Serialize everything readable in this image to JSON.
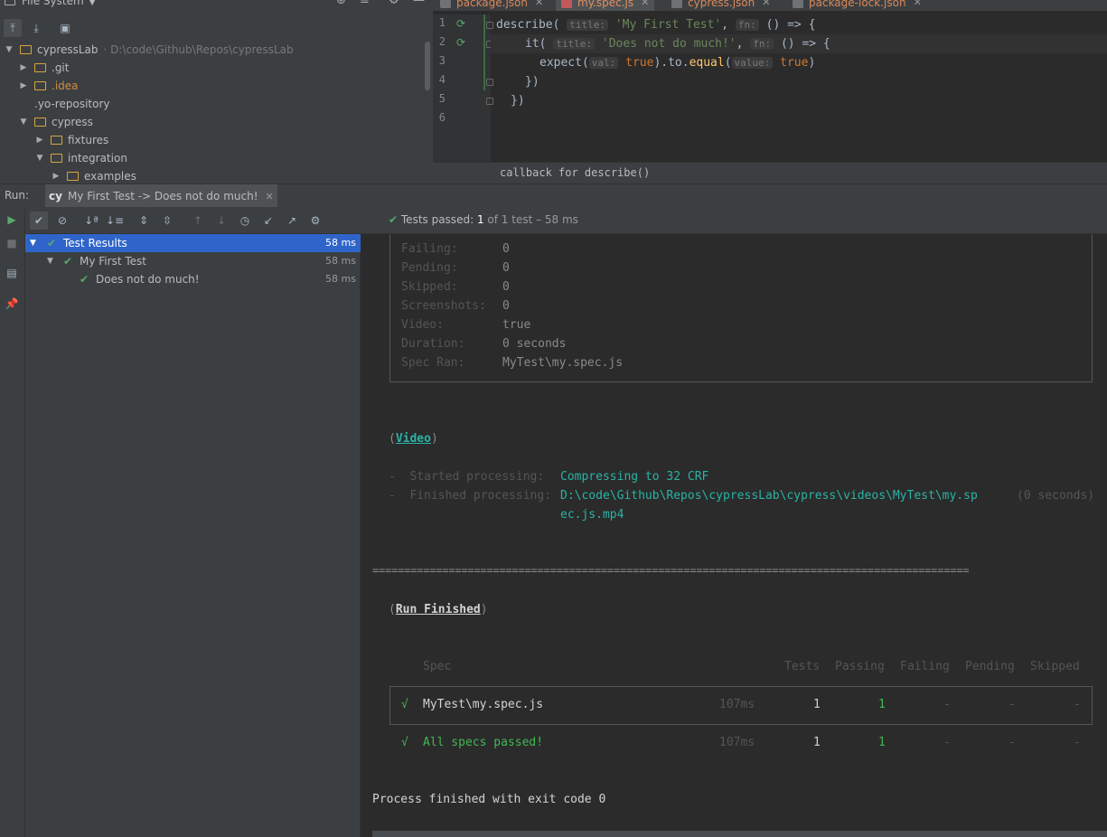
{
  "project_panel": {
    "title": "File System",
    "tree": [
      {
        "label": "cypressLab",
        "hint": "D:\\code\\Github\\Repos\\cypressLab",
        "level": 0,
        "expanded": true,
        "type": "folder-open"
      },
      {
        "label": ".git",
        "level": 1,
        "expanded": false,
        "type": "folder"
      },
      {
        "label": ".idea",
        "level": 1,
        "expanded": false,
        "type": "folder"
      },
      {
        "label": ".yo-repository",
        "level": 1,
        "type": "file"
      },
      {
        "label": "cypress",
        "level": 1,
        "expanded": true,
        "type": "folder"
      },
      {
        "label": "fixtures",
        "level": 2,
        "expanded": false,
        "type": "folder"
      },
      {
        "label": "integration",
        "level": 2,
        "expanded": true,
        "type": "folder"
      },
      {
        "label": "examples",
        "level": 3,
        "expanded": false,
        "type": "folder"
      }
    ]
  },
  "editor": {
    "tabs": [
      {
        "label": "package.json",
        "active": false
      },
      {
        "label": "my.spec.js",
        "active": true
      },
      {
        "label": "cypress.json",
        "active": false
      },
      {
        "label": "package-lock.json",
        "active": false
      }
    ],
    "line_numbers": [
      "1",
      "2",
      "3",
      "4",
      "5",
      "6"
    ],
    "code": {
      "l1": {
        "fn": "describe(",
        "hint1": "title:",
        "str": "'My First Test'",
        "comma": ", ",
        "hint2": "fn:",
        "rest": " () => {"
      },
      "l2": {
        "fn": "it(",
        "hint1": "title:",
        "str": "'Does not do much!'",
        "comma": ", ",
        "hint2": "fn:",
        "rest": " () => {"
      },
      "l3": {
        "fn": "expect(",
        "hint1": "val:",
        "v1": "true",
        "mid": ").to.",
        "m": "equal",
        "paren": "(",
        "hint2": "value:",
        "v2": "true",
        "close": ")"
      },
      "l4": "})",
      "l5": "})"
    },
    "breadcrumb": "callback for describe()"
  },
  "run_panel": {
    "label": "Run:",
    "tab_prefix": "cy",
    "tab_label": "My First Test -> Does not do much!",
    "status_prefix": "Tests passed:",
    "status_count": "1",
    "status_rest": "of 1 test – 58 ms",
    "results": [
      {
        "label": "Test Results",
        "duration": "58 ms",
        "level": 0,
        "selected": true
      },
      {
        "label": "My First Test",
        "duration": "58 ms",
        "level": 1,
        "selected": false
      },
      {
        "label": "Does not do much!",
        "duration": "58 ms",
        "level": 2,
        "selected": false
      }
    ]
  },
  "console": {
    "stats": [
      {
        "key": "Failing:",
        "value": "0"
      },
      {
        "key": "Pending:",
        "value": "0"
      },
      {
        "key": "Skipped:",
        "value": "0"
      },
      {
        "key": "Screenshots:",
        "value": "0"
      },
      {
        "key": "Video:",
        "value": "true"
      },
      {
        "key": "Duration:",
        "value": "0 seconds"
      },
      {
        "key": "Spec Ran:",
        "value": "MyTest\\my.spec.js"
      }
    ],
    "video_heading": "Video",
    "started_label": "-  Started processing:",
    "started_value": "Compressing to 32 CRF",
    "finished_label": "-  Finished processing:",
    "finished_value_1": "D:\\code\\Github\\Repos\\cypressLab\\cypress\\videos\\MyTest\\my.sp",
    "finished_value_2": "ec.js.mp4",
    "finished_time": "(0 seconds)",
    "separator": "==============================================================================================",
    "run_finished": "Run Finished",
    "table_headers": {
      "spec": "Spec",
      "tests": "Tests",
      "passing": "Passing",
      "failing": "Failing",
      "pending": "Pending",
      "skipped": "Skipped"
    },
    "row": {
      "check": "√",
      "spec": "MyTest\\my.spec.js",
      "time": "107ms",
      "tests": "1",
      "passing": "1",
      "failing": "-",
      "pending": "-",
      "skipped": "-"
    },
    "summary": {
      "check": "√",
      "label": "All specs passed!",
      "time": "107ms",
      "tests": "1",
      "passing": "1",
      "failing": "-",
      "pending": "-",
      "skipped": "-"
    },
    "exit": "Process finished with exit code 0"
  }
}
